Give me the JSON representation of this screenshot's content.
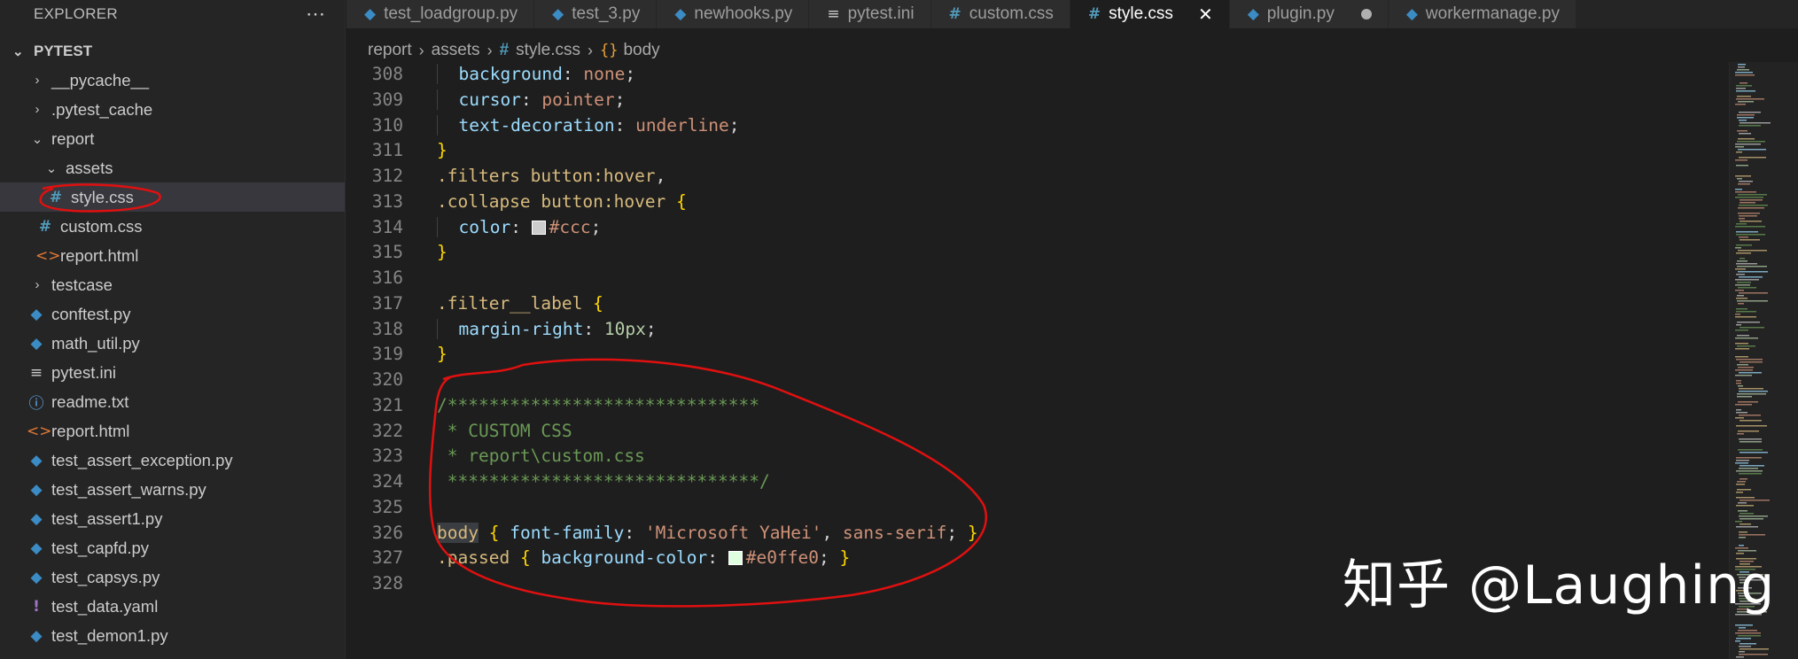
{
  "sidebar": {
    "title": "EXPLORER",
    "more_icon": "ellipsis-icon",
    "workspace": "PYTEST",
    "items": [
      {
        "label": "__pycache__",
        "kind": "folder",
        "chevron": "›",
        "depth": 1
      },
      {
        "label": ".pytest_cache",
        "kind": "folder",
        "chevron": "›",
        "depth": 1
      },
      {
        "label": "report",
        "kind": "folder",
        "chevron": "⌄",
        "depth": 1
      },
      {
        "label": "assets",
        "kind": "folder",
        "chevron": "⌄",
        "depth": 2
      },
      {
        "label": "style.css",
        "kind": "css",
        "icon": "#",
        "depth": 3,
        "selected": true
      },
      {
        "label": "custom.css",
        "kind": "css",
        "icon": "#",
        "depth": 2
      },
      {
        "label": "report.html",
        "kind": "html",
        "icon": "<>",
        "depth": 2
      },
      {
        "label": "testcase",
        "kind": "folder",
        "chevron": "›",
        "depth": 1
      },
      {
        "label": "conftest.py",
        "kind": "py",
        "icon": "◆",
        "depth": 1
      },
      {
        "label": "math_util.py",
        "kind": "py",
        "icon": "◆",
        "depth": 1
      },
      {
        "label": "pytest.ini",
        "kind": "ini",
        "icon": "≡",
        "depth": 1
      },
      {
        "label": "readme.txt",
        "kind": "txt",
        "icon": "ⓘ",
        "depth": 1
      },
      {
        "label": "report.html",
        "kind": "html",
        "icon": "<>",
        "depth": 1
      },
      {
        "label": "test_assert_exception.py",
        "kind": "py",
        "icon": "◆",
        "depth": 1
      },
      {
        "label": "test_assert_warns.py",
        "kind": "py",
        "icon": "◆",
        "depth": 1
      },
      {
        "label": "test_assert1.py",
        "kind": "py",
        "icon": "◆",
        "depth": 1
      },
      {
        "label": "test_capfd.py",
        "kind": "py",
        "icon": "◆",
        "depth": 1
      },
      {
        "label": "test_capsys.py",
        "kind": "py",
        "icon": "◆",
        "depth": 1
      },
      {
        "label": "test_data.yaml",
        "kind": "yaml",
        "icon": "!",
        "depth": 1
      },
      {
        "label": "test_demon1.py",
        "kind": "py",
        "icon": "◆",
        "depth": 1
      }
    ]
  },
  "tabs": [
    {
      "label": "test_loadgroup.py",
      "icon": "◆",
      "kind": "py"
    },
    {
      "label": "test_3.py",
      "icon": "◆",
      "kind": "py"
    },
    {
      "label": "newhooks.py",
      "icon": "◆",
      "kind": "py"
    },
    {
      "label": "pytest.ini",
      "icon": "≡",
      "kind": "ini"
    },
    {
      "label": "custom.css",
      "icon": "#",
      "kind": "css"
    },
    {
      "label": "style.css",
      "icon": "#",
      "kind": "css",
      "active": true,
      "close": "✕"
    },
    {
      "label": "plugin.py",
      "icon": "◆",
      "kind": "py",
      "dirty": true
    },
    {
      "label": "workermanage.py",
      "icon": "◆",
      "kind": "py"
    }
  ],
  "breadcrumb": {
    "segments": [
      "report",
      "assets"
    ],
    "file_icon": "#",
    "file": "style.css",
    "symbol_icon": "{}",
    "symbol": "body"
  },
  "editor": {
    "swatch_ccc": "#cccccc",
    "swatch_e0ffe0": "#e0ffe0",
    "annotation_color": "#e01010",
    "lines": [
      {
        "n": "308",
        "tokens": [
          [
            "ind",
            "  "
          ],
          [
            "prop",
            "background"
          ],
          [
            "punc",
            ": "
          ],
          [
            "val",
            "none"
          ],
          [
            "punc",
            ";"
          ]
        ]
      },
      {
        "n": "309",
        "tokens": [
          [
            "ind",
            "  "
          ],
          [
            "prop",
            "cursor"
          ],
          [
            "punc",
            ": "
          ],
          [
            "val",
            "pointer"
          ],
          [
            "punc",
            ";"
          ]
        ]
      },
      {
        "n": "310",
        "tokens": [
          [
            "ind",
            "  "
          ],
          [
            "prop",
            "text-decoration"
          ],
          [
            "punc",
            ": "
          ],
          [
            "val",
            "underline"
          ],
          [
            "punc",
            ";"
          ]
        ]
      },
      {
        "n": "311",
        "tokens": [
          [
            "brace",
            "}"
          ]
        ]
      },
      {
        "n": "312",
        "tokens": [
          [
            "sel",
            ".filters"
          ],
          [
            "punc",
            " "
          ],
          [
            "sel",
            "button:hover"
          ],
          [
            "punc",
            ","
          ]
        ]
      },
      {
        "n": "313",
        "tokens": [
          [
            "sel",
            ".collapse"
          ],
          [
            "punc",
            " "
          ],
          [
            "sel",
            "button:hover"
          ],
          [
            "punc",
            " "
          ],
          [
            "brace",
            "{"
          ]
        ]
      },
      {
        "n": "314",
        "tokens": [
          [
            "ind",
            "  "
          ],
          [
            "prop",
            "color"
          ],
          [
            "punc",
            ": "
          ],
          [
            "swatch",
            "swatch_ccc"
          ],
          [
            "val",
            "#ccc"
          ],
          [
            "punc",
            ";"
          ]
        ]
      },
      {
        "n": "315",
        "tokens": [
          [
            "brace",
            "}"
          ]
        ]
      },
      {
        "n": "316",
        "tokens": []
      },
      {
        "n": "317",
        "tokens": [
          [
            "sel",
            ".filter__label"
          ],
          [
            "punc",
            " "
          ],
          [
            "brace",
            "{"
          ]
        ]
      },
      {
        "n": "318",
        "tokens": [
          [
            "ind",
            "  "
          ],
          [
            "prop",
            "margin-right"
          ],
          [
            "punc",
            ": "
          ],
          [
            "num",
            "10px"
          ],
          [
            "punc",
            ";"
          ]
        ]
      },
      {
        "n": "319",
        "tokens": [
          [
            "brace",
            "}"
          ]
        ]
      },
      {
        "n": "320",
        "tokens": []
      },
      {
        "n": "321",
        "tokens": [
          [
            "cmt",
            "/******************************"
          ]
        ]
      },
      {
        "n": "322",
        "tokens": [
          [
            "cmt",
            " * CUSTOM CSS"
          ]
        ]
      },
      {
        "n": "323",
        "tokens": [
          [
            "cmt",
            " * report\\custom.css"
          ]
        ]
      },
      {
        "n": "324",
        "tokens": [
          [
            "cmt",
            " ******************************/"
          ]
        ]
      },
      {
        "n": "325",
        "tokens": []
      },
      {
        "n": "326",
        "tokens": [
          [
            "tagbody",
            "body"
          ],
          [
            "punc",
            " "
          ],
          [
            "brace",
            "{"
          ],
          [
            "punc",
            " "
          ],
          [
            "prop",
            "font-family"
          ],
          [
            "punc",
            ": "
          ],
          [
            "val",
            "'Microsoft YaHei'"
          ],
          [
            "punc",
            ", "
          ],
          [
            "val",
            "sans-serif"
          ],
          [
            "punc",
            "; "
          ],
          [
            "brace",
            "}"
          ]
        ]
      },
      {
        "n": "327",
        "tokens": [
          [
            "sel",
            ".passed"
          ],
          [
            "punc",
            " "
          ],
          [
            "brace",
            "{"
          ],
          [
            "punc",
            " "
          ],
          [
            "prop",
            "background-color"
          ],
          [
            "punc",
            ": "
          ],
          [
            "swatch",
            "swatch_e0ffe0"
          ],
          [
            "val",
            "#e0ffe0"
          ],
          [
            "punc",
            "; "
          ],
          [
            "brace",
            "}"
          ]
        ]
      },
      {
        "n": "328",
        "tokens": []
      }
    ]
  },
  "watermark": "知乎 @Laughing"
}
